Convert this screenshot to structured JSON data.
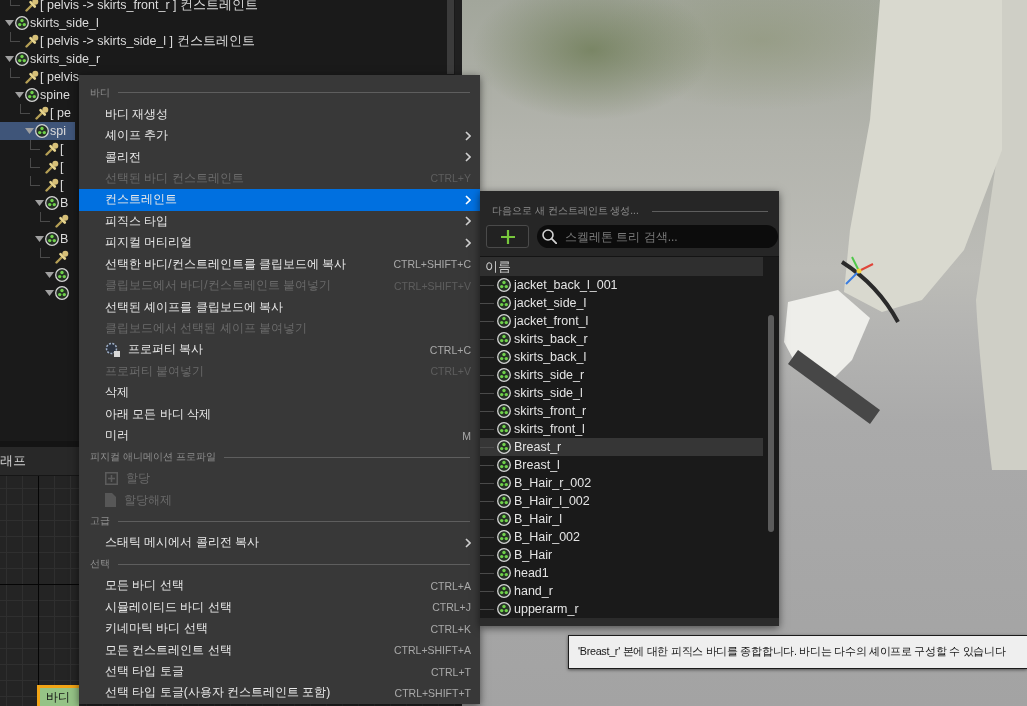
{
  "tree": {
    "items": [
      {
        "children": [
          {
            "kind": "constraint",
            "label": "[ pelvis -> skirts_front_r ] 컨스트레인트",
            "selected": false
          }
        ]
      },
      {
        "kind": "body",
        "label": "skirts_side_l",
        "expanded": true,
        "selected": false,
        "children": [
          {
            "kind": "constraint",
            "label": "[ pelvis -> skirts_side_l ] 컨스트레인트",
            "selected": false
          }
        ]
      },
      {
        "kind": "body",
        "label": "skirts_side_r",
        "expanded": true,
        "selected": false,
        "children": [
          {
            "kind": "constraint",
            "label": "[ pelvis",
            "selected": false
          },
          {
            "kind": "body",
            "label": "spine",
            "expanded": true,
            "selected": false,
            "children": [
              {
                "kind": "constraint",
                "label": "[ pe",
                "selected": false
              },
              {
                "kind": "body",
                "label": "spi",
                "expanded": true,
                "selected": true,
                "children": [
                  {
                    "kind": "constraint",
                    "label": "[",
                    "selected": false
                  },
                  {
                    "kind": "constraint",
                    "label": "[",
                    "selected": false
                  },
                  {
                    "kind": "constraint",
                    "label": "[",
                    "selected": false
                  },
                  {
                    "kind": "body",
                    "label": "B",
                    "expanded": true,
                    "selected": false,
                    "children": [
                      {
                        "kind": "constraint",
                        "selected": false
                      }
                    ]
                  },
                  {
                    "kind": "body",
                    "label": "B",
                    "expanded": true,
                    "selected": false,
                    "children": [
                      {
                        "kind": "constraint",
                        "selected": false
                      },
                      {
                        "kind": "body",
                        "expanded": true,
                        "selected": false
                      },
                      {
                        "kind": "body",
                        "expanded": true,
                        "selected": false
                      }
                    ]
                  }
                ]
              }
            ]
          }
        ]
      }
    ]
  },
  "graph_panel": {
    "tab": "래프",
    "nodes": [
      {
        "label": "바디"
      }
    ]
  },
  "context_menu": {
    "sections": [
      {
        "heading": "바디",
        "items": [
          {
            "kind": "item",
            "label": "바디 재생성",
            "submenu": false,
            "disabled": false,
            "selected": false
          },
          {
            "kind": "item",
            "label": "셰이프 추가",
            "submenu": true,
            "disabled": false,
            "selected": false
          },
          {
            "kind": "item",
            "label": "콜리전",
            "submenu": true,
            "disabled": false,
            "selected": false
          },
          {
            "kind": "item",
            "label": "선택된 바디 컨스트레인트",
            "shortcut": "CTRL+Y",
            "submenu": false,
            "disabled": true,
            "selected": false
          },
          {
            "kind": "item",
            "label": "컨스트레인트",
            "submenu": true,
            "disabled": false,
            "selected": true
          },
          {
            "kind": "item",
            "label": "피직스 타입",
            "submenu": true,
            "disabled": false,
            "selected": false
          },
          {
            "kind": "item",
            "label": "피지컬 머티리얼",
            "submenu": true,
            "disabled": false,
            "selected": false
          },
          {
            "kind": "item",
            "label": "선택한 바디/컨스트레인트를 클립보드에 복사",
            "shortcut": "CTRL+SHIFT+C",
            "submenu": false,
            "disabled": false,
            "selected": false
          },
          {
            "kind": "item",
            "label": "클립보드에서 바디/컨스트레인트 붙여넣기",
            "shortcut": "CTRL+SHIFT+V",
            "submenu": false,
            "disabled": true,
            "selected": false
          },
          {
            "kind": "item",
            "label": "선택된 셰이프를 클립보드에 복사",
            "submenu": false,
            "disabled": false,
            "selected": false
          },
          {
            "kind": "item",
            "label": "클립보드에서 선택된 셰이프 붙여넣기",
            "submenu": false,
            "disabled": true,
            "selected": false
          },
          {
            "kind": "copy",
            "label": "프로퍼티 복사",
            "shortcut": "CTRL+C",
            "submenu": false,
            "disabled": false,
            "selected": false
          },
          {
            "kind": "item",
            "label": "프로퍼티 붙여넣기",
            "shortcut": "CTRL+V",
            "submenu": false,
            "disabled": true,
            "selected": false
          },
          {
            "kind": "item",
            "label": "삭제",
            "submenu": false,
            "disabled": false,
            "selected": false
          },
          {
            "kind": "item",
            "label": "아래 모든 바디 삭제",
            "submenu": false,
            "disabled": false,
            "selected": false
          },
          {
            "kind": "item",
            "label": "미러",
            "shortcut": "M",
            "submenu": false,
            "disabled": false,
            "selected": false
          }
        ]
      },
      {
        "heading": "피지컬 애니메이션 프로파일",
        "items": [
          {
            "kind": "assign",
            "label": "할당",
            "submenu": false,
            "disabled": true,
            "selected": false
          },
          {
            "kind": "unassign",
            "label": "할당해제",
            "submenu": false,
            "disabled": true,
            "selected": false
          }
        ]
      },
      {
        "heading": "고급",
        "items": [
          {
            "kind": "item",
            "label": "스태틱 메시에서 콜리전 복사",
            "submenu": true,
            "disabled": false,
            "selected": false
          }
        ]
      },
      {
        "heading": "선택",
        "items": [
          {
            "kind": "item",
            "label": "모든 바디 선택",
            "shortcut": "CTRL+A",
            "submenu": false,
            "disabled": false,
            "selected": false
          },
          {
            "kind": "item",
            "label": "시뮬레이티드 바디 선택",
            "shortcut": "CTRL+J",
            "submenu": false,
            "disabled": false,
            "selected": false
          },
          {
            "kind": "item",
            "label": "키네마틱 바디 선택",
            "shortcut": "CTRL+K",
            "submenu": false,
            "disabled": false,
            "selected": false
          },
          {
            "kind": "item",
            "label": "모든 컨스트레인트 선택",
            "shortcut": "CTRL+SHIFT+A",
            "submenu": false,
            "disabled": false,
            "selected": false
          },
          {
            "kind": "item",
            "label": "선택 타입 토글",
            "shortcut": "CTRL+T",
            "submenu": false,
            "disabled": false,
            "selected": false
          },
          {
            "kind": "item",
            "label": "선택 타입 토글(사용자 컨스트레인트 포함)",
            "shortcut": "CTRL+SHIFT+T",
            "submenu": false,
            "disabled": false,
            "selected": false
          }
        ]
      }
    ]
  },
  "constraint_submenu": {
    "heading": "다음으로 새 컨스트레인트 생성...",
    "search": {
      "placeholder": "스켈레톤 트리 검색..."
    },
    "column": "이름",
    "rows": [
      {
        "label": "jacket_back_l_001",
        "selected": false
      },
      {
        "label": "jacket_side_l",
        "selected": false
      },
      {
        "label": "jacket_front_l",
        "selected": false
      },
      {
        "label": "skirts_back_r",
        "selected": false
      },
      {
        "label": "skirts_back_l",
        "selected": false
      },
      {
        "label": "skirts_side_r",
        "selected": false
      },
      {
        "label": "skirts_side_l",
        "selected": false
      },
      {
        "label": "skirts_front_r",
        "selected": false
      },
      {
        "label": "skirts_front_l",
        "selected": false
      },
      {
        "label": "Breast_r",
        "selected": true
      },
      {
        "label": "Breast_l",
        "selected": false
      },
      {
        "label": "B_Hair_r_002",
        "selected": false
      },
      {
        "label": "B_Hair_l_002",
        "selected": false
      },
      {
        "label": "B_Hair_l",
        "selected": false
      },
      {
        "label": "B_Hair_002",
        "selected": false
      },
      {
        "label": "B_Hair",
        "selected": false
      },
      {
        "label": "head1",
        "selected": false
      },
      {
        "label": "hand_r",
        "selected": false
      },
      {
        "label": "upperarm_r",
        "selected": false
      }
    ]
  },
  "tooltip": {
    "text": "'Breast_r' 본에 대한 피직스 바디를 종합합니다. 바디는 다수의 셰이프로 구성할 수 있습니다"
  }
}
